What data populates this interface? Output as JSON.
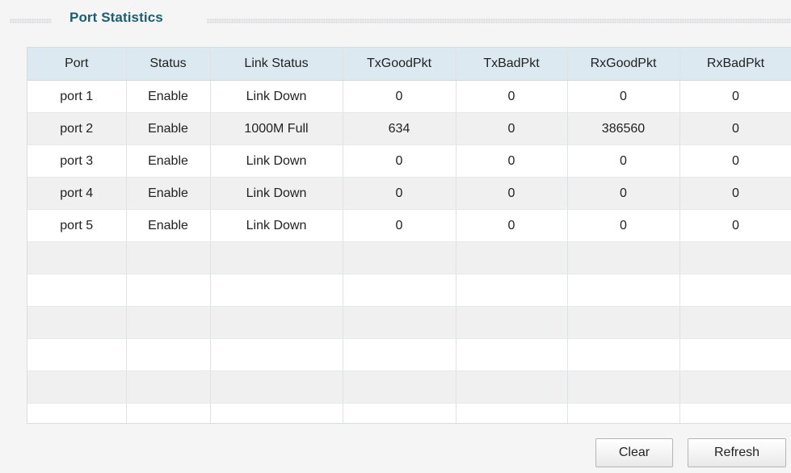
{
  "section": {
    "title": "Port Statistics"
  },
  "table": {
    "headers": [
      "Port",
      "Status",
      "Link Status",
      "TxGoodPkt",
      "TxBadPkt",
      "RxGoodPkt",
      "RxBadPkt"
    ],
    "rows": [
      [
        "port 1",
        "Enable",
        "Link Down",
        "0",
        "0",
        "0",
        "0"
      ],
      [
        "port 2",
        "Enable",
        "1000M Full",
        "634",
        "0",
        "386560",
        "0"
      ],
      [
        "port 3",
        "Enable",
        "Link Down",
        "0",
        "0",
        "0",
        "0"
      ],
      [
        "port 4",
        "Enable",
        "Link Down",
        "0",
        "0",
        "0",
        "0"
      ],
      [
        "port 5",
        "Enable",
        "Link Down",
        "0",
        "0",
        "0",
        "0"
      ],
      [
        "",
        "",
        "",
        "",
        "",
        "",
        ""
      ],
      [
        "",
        "",
        "",
        "",
        "",
        "",
        ""
      ],
      [
        "",
        "",
        "",
        "",
        "",
        "",
        ""
      ],
      [
        "",
        "",
        "",
        "",
        "",
        "",
        ""
      ],
      [
        "",
        "",
        "",
        "",
        "",
        "",
        ""
      ],
      [
        "",
        "",
        "",
        "",
        "",
        "",
        ""
      ]
    ]
  },
  "buttons": {
    "clear_label": "Clear",
    "refresh_label": "Refresh"
  },
  "colors": {
    "title": "#1b5e74",
    "header_bg": "#dde9f0",
    "row_alt_bg": "#f0f0f0"
  }
}
